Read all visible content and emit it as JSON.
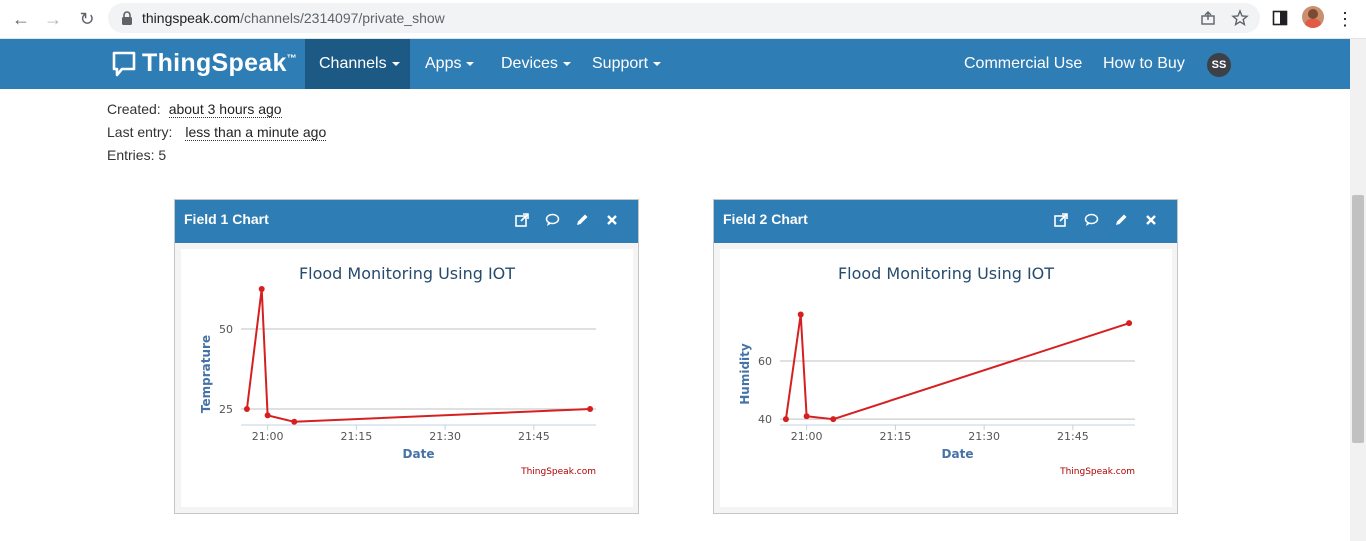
{
  "browser": {
    "url_host": "thingspeak.com",
    "url_path": "/channels/2314097/private_show"
  },
  "nav": {
    "brand": "ThingSpeak",
    "brand_tm": "™",
    "channels": "Channels",
    "apps": "Apps",
    "devices": "Devices",
    "support": "Support",
    "commercial": "Commercial Use",
    "how_to_buy": "How to Buy",
    "user_initials": "SS"
  },
  "channel": {
    "created_label": "Created:",
    "created_value": "about 3 hours ago",
    "last_entry_label": "Last entry:",
    "last_entry_value": "less than a minute ago",
    "entries": "Entries: 5"
  },
  "panels": [
    {
      "title": "Field 1 Chart"
    },
    {
      "title": "Field 2 Chart"
    }
  ],
  "colors": {
    "header_blue": "#2e7db5",
    "active_nav": "#1c5a85",
    "series_red": "#d62020",
    "axis_label_blue": "#4572a7"
  },
  "chart_data": [
    {
      "type": "line",
      "title": "Flood Monitoring Using IOT",
      "xlabel": "Date",
      "ylabel": "Temprature",
      "credit": "ThingSpeak.com",
      "xticks": [
        "21:00",
        "21:15",
        "21:30",
        "21:45"
      ],
      "xtick_minutes": [
        0,
        15,
        30,
        45
      ],
      "yticks": [
        25,
        50
      ],
      "xlim_minutes": [
        -4.5,
        55.5
      ],
      "ylim": [
        20,
        60
      ],
      "series": [
        {
          "x_minutes": [
            -3.5,
            -1.0,
            0.0,
            4.5,
            54.5
          ],
          "y": [
            25.0,
            62.5,
            23.0,
            21.0,
            25.0
          ]
        }
      ]
    },
    {
      "type": "line",
      "title": "Flood Monitoring Using IOT",
      "xlabel": "Date",
      "ylabel": "Humidity",
      "credit": "ThingSpeak.com",
      "xticks": [
        "21:00",
        "21:15",
        "21:30",
        "21:45"
      ],
      "xtick_minutes": [
        0,
        15,
        30,
        45
      ],
      "yticks": [
        40,
        60
      ],
      "xlim_minutes": [
        -4.5,
        55.5
      ],
      "ylim": [
        38,
        82
      ],
      "series": [
        {
          "x_minutes": [
            -3.5,
            -1.0,
            0.0,
            4.5,
            54.5
          ],
          "y": [
            40.0,
            76.0,
            41.0,
            40.0,
            73.0
          ]
        }
      ]
    }
  ]
}
